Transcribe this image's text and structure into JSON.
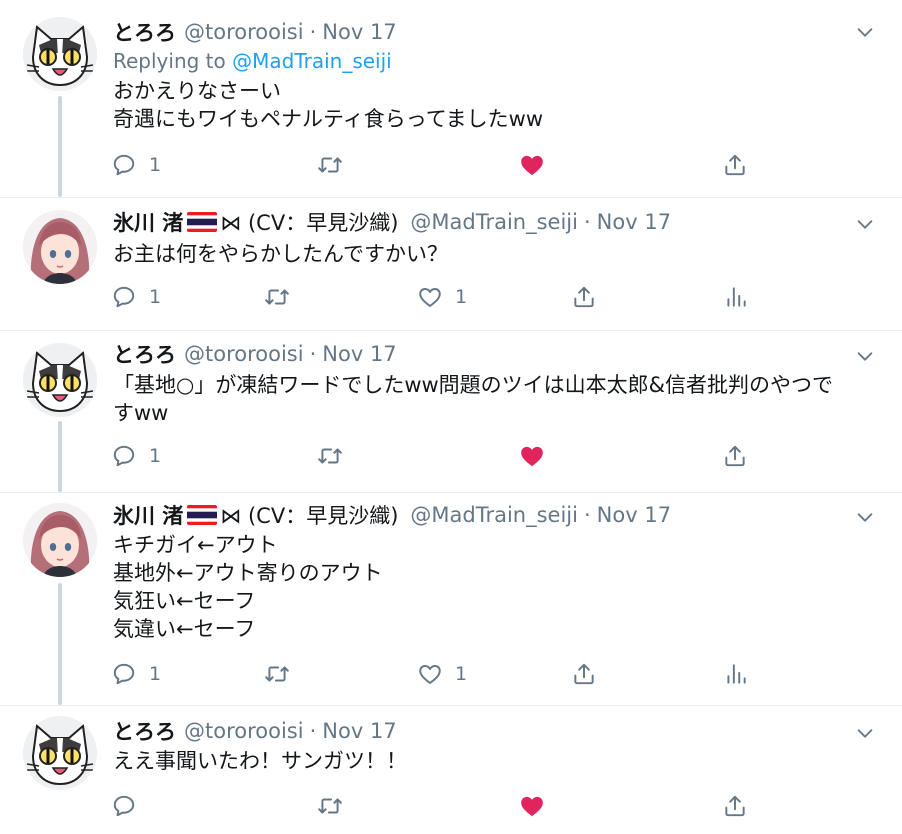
{
  "tweets": [
    {
      "name": "とろろ",
      "handle": "@tororooisi",
      "separator": "·",
      "date": "Nov 17",
      "replying_prefix": "Replying to",
      "replying_to": "@MadTrain_seiji",
      "lines": [
        "おかえりなさーい",
        "奇遇にもワイもペナルティ食らってましたww"
      ],
      "reply_count": "1",
      "liked": true
    },
    {
      "name": "氷川 渚",
      "name_suffix": "⋈ (CV：早見沙織)",
      "handle": "@MadTrain_seiji",
      "separator": "·",
      "date": "Nov 17",
      "lines": [
        "お主は何をやらかしたんですかい？"
      ],
      "reply_count": "1",
      "like_count": "1",
      "liked": false
    },
    {
      "name": "とろろ",
      "handle": "@tororooisi",
      "separator": "·",
      "date": "Nov 17",
      "lines": [
        "「基地○」が凍結ワードでしたww問題のツイは山本太郎&信者批判のやつで",
        "すww"
      ],
      "reply_count": "1",
      "liked": true
    },
    {
      "name": "氷川 渚",
      "name_suffix": "⋈ (CV：早見沙織)",
      "handle": "@MadTrain_seiji",
      "separator": "·",
      "date": "Nov 17",
      "lines": [
        "キチガイ←アウト",
        "基地外←アウト寄りのアウト",
        "気狂い←セーフ",
        "気違い←セーフ"
      ],
      "reply_count": "1",
      "like_count": "1",
      "liked": false
    },
    {
      "name": "とろろ",
      "handle": "@tororooisi",
      "separator": "·",
      "date": "Nov 17",
      "lines": [
        "ええ事聞いたわ！サンガツ！！"
      ],
      "liked": true
    }
  ],
  "colors": {
    "text": "#14171a",
    "secondary": "#657786",
    "link": "#1da1f2",
    "like": "#e0245e",
    "divider": "#e6ecf0",
    "thread_line": "#ccd6dd"
  },
  "icons": {
    "reply": "reply-icon",
    "retweet": "retweet-icon",
    "like": "heart-icon",
    "share": "share-icon",
    "analytics": "analytics-icon",
    "caret": "chevron-down-icon",
    "flag": "thailand-flag-icon"
  }
}
